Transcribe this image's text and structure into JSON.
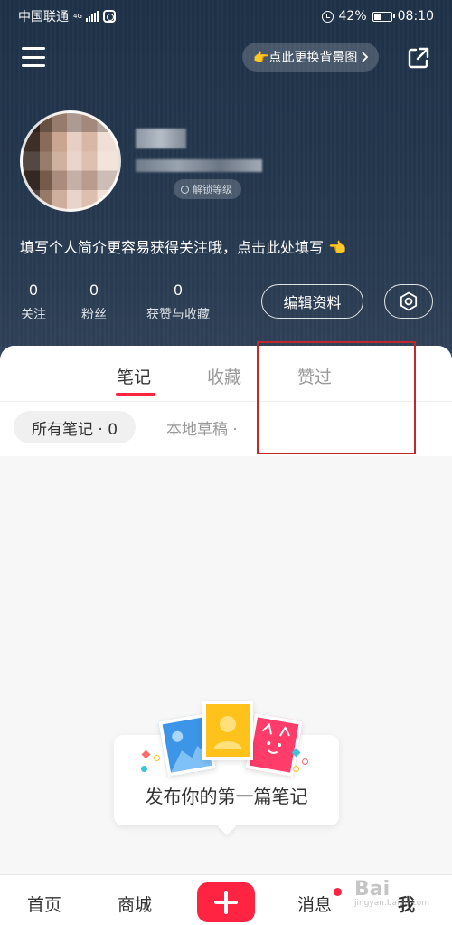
{
  "status_bar": {
    "carrier": "中国联通",
    "network": "4G",
    "battery": "42%",
    "time": "08:10",
    "battery_level": 0.42
  },
  "header": {
    "change_background_label": "👉点此更换背景图",
    "level_chip_label": "解锁等级"
  },
  "profile": {
    "bio_prompt": "填写个人简介更容易获得关注哦，点击此处填写 👈",
    "stats": [
      {
        "value": "0",
        "label": "关注"
      },
      {
        "value": "0",
        "label": "粉丝"
      },
      {
        "value": "0",
        "label": "获赞与收藏"
      }
    ],
    "edit_profile_label": "编辑资料"
  },
  "tabs": [
    {
      "label": "笔记",
      "active": true
    },
    {
      "label": "收藏",
      "active": false
    },
    {
      "label": "赞过",
      "active": false
    }
  ],
  "filters": {
    "all_notes": "所有笔记 · 0",
    "drafts": "本地草稿 ·"
  },
  "empty_state": {
    "message": "发布你的第一篇笔记"
  },
  "bottom_nav": {
    "home": "首页",
    "mall": "商城",
    "messages": "消息",
    "me": "我"
  },
  "watermark": {
    "brand": "Bai",
    "sub": "jingyan.baidu.com"
  },
  "colors": {
    "accent": "#ff2442",
    "highlight_box": "#c0282e"
  },
  "icons": [
    "menu-icon",
    "share-icon",
    "settings-icon",
    "plus-icon"
  ]
}
